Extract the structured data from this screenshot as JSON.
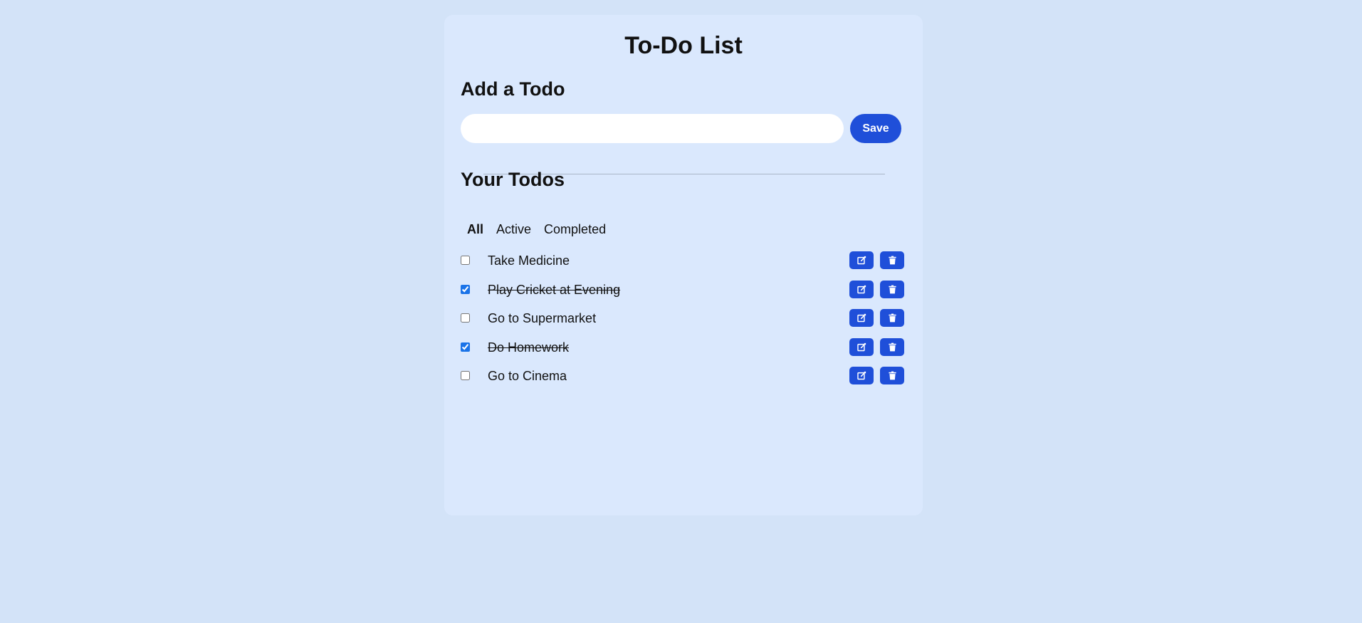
{
  "app": {
    "title": "To-Do List"
  },
  "add_section": {
    "heading": "Add a Todo",
    "input_value": "",
    "input_placeholder": "",
    "save_label": "Save"
  },
  "todos_section": {
    "heading": "Your Todos",
    "filters": [
      {
        "label": "All",
        "active": true
      },
      {
        "label": "Active",
        "active": false
      },
      {
        "label": "Completed",
        "active": false
      }
    ],
    "items": [
      {
        "text": "Take Medicine",
        "completed": false
      },
      {
        "text": "Play Cricket at Evening",
        "completed": true
      },
      {
        "text": "Go to Supermarket",
        "completed": false
      },
      {
        "text": "Do Homework",
        "completed": true
      },
      {
        "text": "Go to Cinema",
        "completed": false
      }
    ],
    "item_actions": {
      "edit_icon": "edit-icon",
      "delete_icon": "trash-icon"
    }
  },
  "colors": {
    "page_background": "#d3e3f8",
    "card_background": "#dae8fd",
    "accent": "#1f4fd9"
  }
}
